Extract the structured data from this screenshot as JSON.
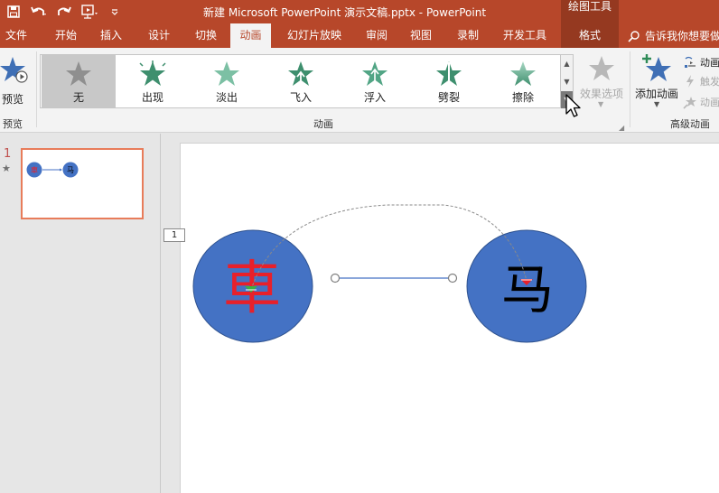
{
  "titlebar": {
    "title": "新建 Microsoft PowerPoint 演示文稿.pptx  -  PowerPoint",
    "context_tool": "绘图工具"
  },
  "tabs": [
    "文件",
    "开始",
    "插入",
    "设计",
    "切换",
    "动画",
    "幻灯片放映",
    "审阅",
    "视图",
    "录制",
    "开发工具",
    "格式"
  ],
  "active_tab": "动画",
  "tell_me": "告诉我你想要做",
  "ribbon": {
    "preview": {
      "label": "预览",
      "group": "预览"
    },
    "animation_group": "动画",
    "gallery": [
      {
        "label": "无",
        "icon": "star-none-icon",
        "selected": true
      },
      {
        "label": "出现",
        "icon": "star-appear-icon"
      },
      {
        "label": "淡出",
        "icon": "star-fade-icon"
      },
      {
        "label": "飞入",
        "icon": "star-fly-in-icon"
      },
      {
        "label": "浮入",
        "icon": "star-float-in-icon"
      },
      {
        "label": "劈裂",
        "icon": "star-split-icon"
      },
      {
        "label": "擦除",
        "icon": "star-wipe-icon"
      }
    ],
    "effect_options": "效果选项",
    "add_animation": "添加动画",
    "advanced": {
      "group": "高级动画",
      "items": [
        "动画",
        "触发",
        "动画"
      ]
    }
  },
  "slide_panel": {
    "number": "1"
  },
  "slide": {
    "left_char": "車",
    "right_char": "马",
    "order_tag": "1"
  },
  "colors": {
    "accent": "#b7472a",
    "context_tab": "#953920",
    "circle": "#4472c4",
    "left_char": "#e8202a",
    "gallery_star": "#52a585"
  }
}
